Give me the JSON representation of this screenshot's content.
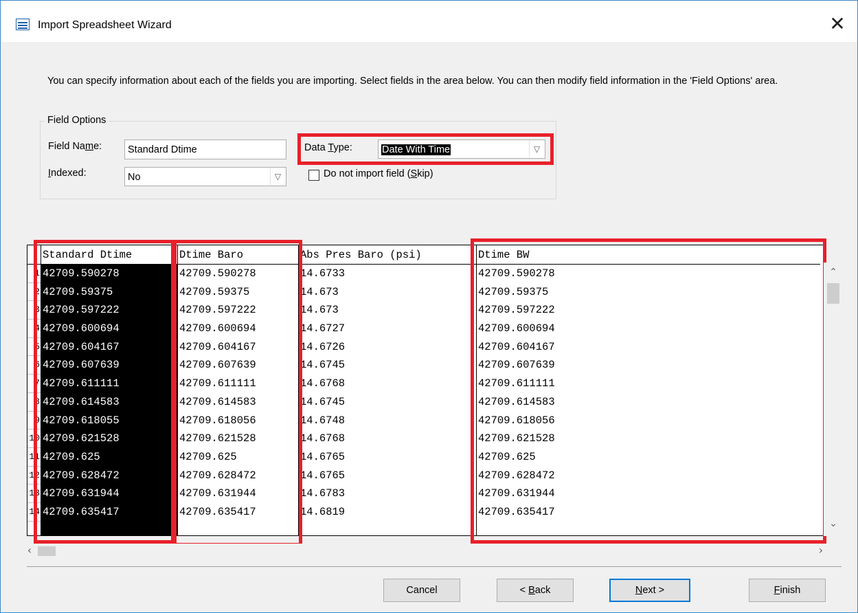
{
  "window": {
    "title": "Import Spreadsheet Wizard",
    "close_icon": "close-icon",
    "app_icon": "spreadsheet-icon"
  },
  "instructions": "You can specify information about each of the fields you are importing. Select fields in the area below. You can then modify field information in the 'Field Options' area.",
  "field_options": {
    "legend": "Field Options",
    "field_name_label_pre": "Field Na",
    "field_name_label_ul": "m",
    "field_name_label_post": "e:",
    "field_name_value": "Standard Dtime",
    "indexed_label_ul": "I",
    "indexed_label_post": "ndexed:",
    "indexed_value": "No",
    "data_type_label_pre": "Data ",
    "data_type_label_ul": "T",
    "data_type_label_post": "ype:",
    "data_type_value": "Date With Time",
    "skip_label_pre": "Do not import field (",
    "skip_label_ul": "S",
    "skip_label_post": "kip)",
    "skip_checked": false
  },
  "grid": {
    "columns": [
      "Standard Dtime",
      "Dtime Baro",
      "Abs Pres Baro (psi)",
      "Dtime BW"
    ],
    "selected_column": 0,
    "row_numbers": [
      "1",
      "2",
      "3",
      "4",
      "5",
      "6",
      "7",
      "8",
      "9",
      "10",
      "11",
      "12",
      "13",
      "14"
    ],
    "rows": [
      [
        "42709.590278",
        "42709.590278",
        "14.6733",
        "42709.590278"
      ],
      [
        "42709.59375",
        "42709.59375",
        "14.673",
        "42709.59375"
      ],
      [
        "42709.597222",
        "42709.597222",
        "14.673",
        "42709.597222"
      ],
      [
        "42709.600694",
        "42709.600694",
        "14.6727",
        "42709.600694"
      ],
      [
        "42709.604167",
        "42709.604167",
        "14.6726",
        "42709.604167"
      ],
      [
        "42709.607639",
        "42709.607639",
        "14.6745",
        "42709.607639"
      ],
      [
        "42709.611111",
        "42709.611111",
        "14.6768",
        "42709.611111"
      ],
      [
        "42709.614583",
        "42709.614583",
        "14.6745",
        "42709.614583"
      ],
      [
        "42709.618055",
        "42709.618056",
        "14.6748",
        "42709.618056"
      ],
      [
        "42709.621528",
        "42709.621528",
        "14.6768",
        "42709.621528"
      ],
      [
        "42709.625",
        "42709.625",
        "14.6765",
        "42709.625"
      ],
      [
        "42709.628472",
        "42709.628472",
        "14.6765",
        "42709.628472"
      ],
      [
        "42709.631944",
        "42709.631944",
        "14.6783",
        "42709.631944"
      ],
      [
        "42709.635417",
        "42709.635417",
        "14.6819",
        "42709.635417"
      ]
    ]
  },
  "buttons": {
    "cancel": "Cancel",
    "back_pre": "< ",
    "back_ul": "B",
    "back_post": "ack",
    "next_ul": "N",
    "next_post": "ext >",
    "finish_ul": "F",
    "finish_post": "inish"
  },
  "colors": {
    "highlight_box": "#e8202a",
    "default_button_border": "#0078d7",
    "selected_column_bg": "#000000"
  }
}
